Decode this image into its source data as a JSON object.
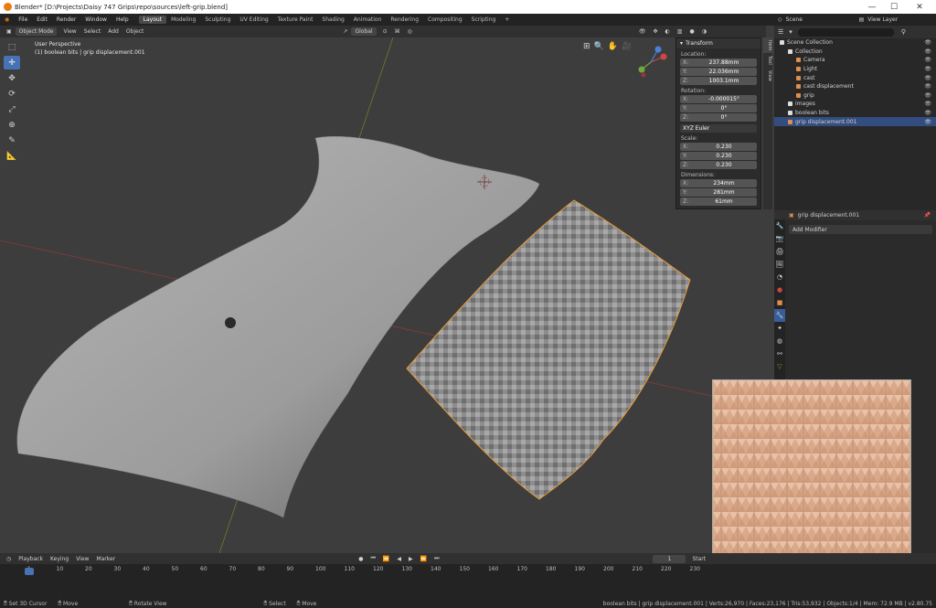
{
  "window": {
    "title": "Blender* [D:\\Projects\\Daisy 747 Grips\\repo\\sources\\left-grip.blend]",
    "minimize": "—",
    "maximize": "☐",
    "close": "✕"
  },
  "menu": [
    "File",
    "Edit",
    "Render",
    "Window",
    "Help"
  ],
  "workspaces": [
    "Layout",
    "Modeling",
    "Sculpting",
    "UV Editing",
    "Texture Paint",
    "Shading",
    "Animation",
    "Rendering",
    "Compositing",
    "Scripting",
    "+"
  ],
  "scene": {
    "label": "Scene",
    "view_layer": "View Layer"
  },
  "header3d": {
    "mode": "Object Mode",
    "view": "View",
    "select": "Select",
    "add": "Add",
    "object": "Object",
    "orientation": "Global"
  },
  "viewport_info": {
    "line1": "User Perspective",
    "line2": "(1) boolean bits | grip displacement.001"
  },
  "npanel": {
    "title": "Transform",
    "location_label": "Location:",
    "location": [
      {
        "k": "X:",
        "v": "237.88mm"
      },
      {
        "k": "Y:",
        "v": "22.036mm"
      },
      {
        "k": "Z:",
        "v": "1003.1mm"
      }
    ],
    "rotation_label": "Rotation:",
    "rotation": [
      {
        "k": "X:",
        "v": "-0.000015°"
      },
      {
        "k": "Y:",
        "v": "0°"
      },
      {
        "k": "Z:",
        "v": "0°"
      }
    ],
    "rotation_mode": "XYZ Euler",
    "scale_label": "Scale:",
    "scale": [
      {
        "k": "X:",
        "v": "0.230"
      },
      {
        "k": "Y:",
        "v": "0.230"
      },
      {
        "k": "Z:",
        "v": "0.230"
      }
    ],
    "dimensions_label": "Dimensions:",
    "dimensions": [
      {
        "k": "X:",
        "v": "234mm"
      },
      {
        "k": "Y:",
        "v": "281mm"
      },
      {
        "k": "Z:",
        "v": "61mm"
      }
    ],
    "tabs": [
      "Item",
      "Tool",
      "View"
    ]
  },
  "outliner": {
    "rows": [
      {
        "name": "Scene Collection",
        "indent": 0,
        "color": "#dddddd"
      },
      {
        "name": "Collection",
        "indent": 1,
        "color": "#dddddd"
      },
      {
        "name": "Camera",
        "indent": 2,
        "color": "#e08e4c"
      },
      {
        "name": "Light",
        "indent": 2,
        "color": "#e08e4c"
      },
      {
        "name": "cast",
        "indent": 2,
        "color": "#e08e4c"
      },
      {
        "name": "cast displacement",
        "indent": 2,
        "color": "#e08e4c"
      },
      {
        "name": "grip",
        "indent": 2,
        "color": "#e08e4c"
      },
      {
        "name": "images",
        "indent": 1,
        "color": "#dddddd"
      },
      {
        "name": "boolean bits",
        "indent": 1,
        "color": "#dddddd"
      },
      {
        "name": "grip displacement.001",
        "indent": 1,
        "color": "#e08e4c",
        "selected": true
      }
    ]
  },
  "properties": {
    "object_name": "grip displacement.001",
    "add_modifier": "Add Modifier"
  },
  "timeline": {
    "playback": "Playback",
    "keying": "Keying",
    "view": "View",
    "marker": "Marker",
    "current_frame": "1",
    "start_label": "Start",
    "ticks": [
      "1",
      "10",
      "20",
      "30",
      "40",
      "50",
      "60",
      "70",
      "80",
      "90",
      "100",
      "110",
      "120",
      "130",
      "140",
      "150",
      "160",
      "170",
      "180",
      "190",
      "200",
      "210",
      "220",
      "230"
    ]
  },
  "status": {
    "left": [
      "Set 3D Cursor",
      "Move",
      "Rotate View",
      "Select",
      "Move"
    ],
    "right": "boolean bits | grip displacement.001 | Verts:26,970 | Faces:23,176 | Tris:53,932 | Objects:1/4 | Mem: 72.9 MB | v2.80.75"
  }
}
